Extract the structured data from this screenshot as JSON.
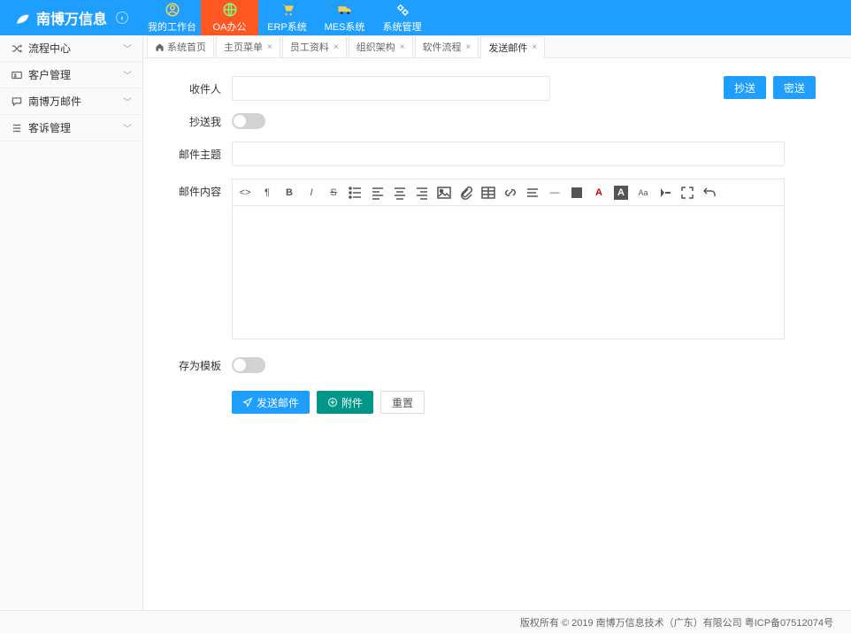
{
  "logo": {
    "text": "南博万信息"
  },
  "topnav": [
    {
      "label": "我的工作台"
    },
    {
      "label": "OA办公"
    },
    {
      "label": "ERP系统"
    },
    {
      "label": "MES系统"
    },
    {
      "label": "系统管理"
    }
  ],
  "sidebar": [
    {
      "label": "流程中心"
    },
    {
      "label": "客户管理"
    },
    {
      "label": "南博万邮件"
    },
    {
      "label": "客诉管理"
    }
  ],
  "tabs": [
    {
      "label": "系统首页",
      "home": true
    },
    {
      "label": "主页菜单"
    },
    {
      "label": "员工资料"
    },
    {
      "label": "组织架构"
    },
    {
      "label": "软件流程"
    },
    {
      "label": "发送邮件",
      "active": true
    }
  ],
  "form": {
    "recipient_label": "收件人",
    "cc_label": "抄送",
    "bcc_label": "密送",
    "cc_me_label": "抄送我",
    "subject_label": "邮件主题",
    "content_label": "邮件内容",
    "save_template_label": "存为模板",
    "send_label": "发送邮件",
    "attach_label": "附件",
    "reset_label": "重置"
  },
  "footer": {
    "text": "版权所有 © 2019 南博万信息技术（广东）有限公司 粤ICP备07512074号"
  }
}
